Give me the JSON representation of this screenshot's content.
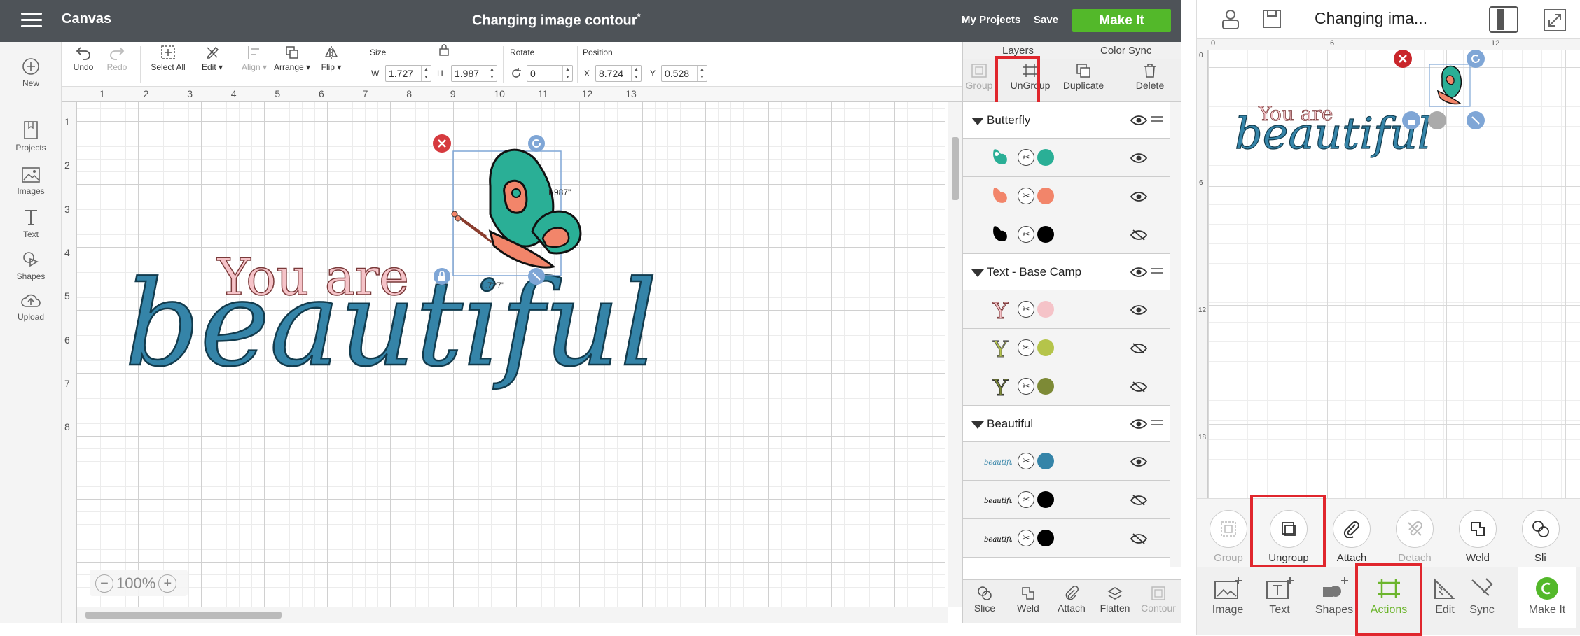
{
  "desktop": {
    "app_title": "Canvas",
    "doc_title": "Changing image contour",
    "doc_title_marker": "*",
    "header_links": {
      "my_projects": "My Projects",
      "save": "Save",
      "make_it": "Make It"
    },
    "left_nav": [
      "New",
      "Projects",
      "Images",
      "Text",
      "Shapes",
      "Upload"
    ],
    "toolbar": {
      "undo": "Undo",
      "redo": "Redo",
      "select_all": "Select All",
      "edit": "Edit",
      "align": "Align",
      "arrange": "Arrange",
      "flip": "Flip",
      "size_label": "Size",
      "w_label": "W",
      "w_value": "1.727",
      "h_label": "H",
      "h_value": "1.987",
      "rotate_label": "Rotate",
      "rotate_value": "0",
      "position_label": "Position",
      "x_label": "X",
      "x_value": "8.724",
      "y_label": "Y",
      "y_value": "0.528"
    },
    "ruler_top": [
      "1",
      "2",
      "3",
      "4",
      "5",
      "6",
      "7",
      "8",
      "9",
      "10",
      "11",
      "12",
      "13"
    ],
    "ruler_left": [
      "1",
      "2",
      "3",
      "4",
      "5",
      "6",
      "7",
      "8"
    ],
    "canvas": {
      "text_you_are": "You are",
      "text_beautiful": "beautiful",
      "dim_height": "1.987\"",
      "dim_width": "1.727\"",
      "zoom": "100%"
    },
    "panel": {
      "tab_layers": "Layers",
      "tab_color_sync": "Color Sync",
      "actions": {
        "group": "Group",
        "ungroup": "UnGroup",
        "duplicate": "Duplicate",
        "delete": "Delete"
      },
      "groups": [
        {
          "name": "Butterfly",
          "children": [
            {
              "color": "#2aaf96",
              "visible": true
            },
            {
              "color": "#f2856a",
              "visible": true
            },
            {
              "color": "#000000",
              "visible": false
            }
          ]
        },
        {
          "name": "Text - Base Camp",
          "children": [
            {
              "letter": "Y",
              "color": "#f5c3c8",
              "visible": true
            },
            {
              "letter": "Y",
              "color": "#b5c44a",
              "visible": false
            },
            {
              "letter": "Y",
              "color": "#7d8a36",
              "visible": false
            }
          ]
        },
        {
          "name": "Beautiful",
          "children": [
            {
              "thumb_text": "beautiful",
              "color": "#3584a8",
              "visible": true
            },
            {
              "thumb_text": "beautiful",
              "color": "#000000",
              "visible": false
            },
            {
              "thumb_text": "beautiful",
              "color": "#000000",
              "visible": false
            }
          ]
        }
      ],
      "bottom": {
        "slice": "Slice",
        "weld": "Weld",
        "attach": "Attach",
        "flatten": "Flatten",
        "contour": "Contour"
      }
    }
  },
  "mobile": {
    "title": "Changing ima...",
    "ruler_top": [
      "0",
      "6",
      "12"
    ],
    "ruler_left": [
      "0",
      "6",
      "12",
      "18"
    ],
    "canvas_text_you_are": "You are",
    "canvas_text_beautiful": "beautiful",
    "actions": [
      "Group",
      "Ungroup",
      "Attach",
      "Detach",
      "Weld",
      "Sli"
    ],
    "tabs": [
      "Image",
      "Text",
      "Shapes",
      "Actions",
      "Edit",
      "Sync",
      "Make It"
    ]
  },
  "colors": {
    "header_bg": "#4e5358",
    "make_it_green": "#53b82a",
    "highlight_red": "#e0262d",
    "beautiful_blue": "#3584a8",
    "you_are_pink": "#f5c3c8",
    "butterfly_teal": "#2aaf96",
    "butterfly_coral": "#f2856a",
    "handle_blue": "#7fa6d6",
    "delete_red": "#d63a3f",
    "actions_green": "#6cb52d"
  }
}
